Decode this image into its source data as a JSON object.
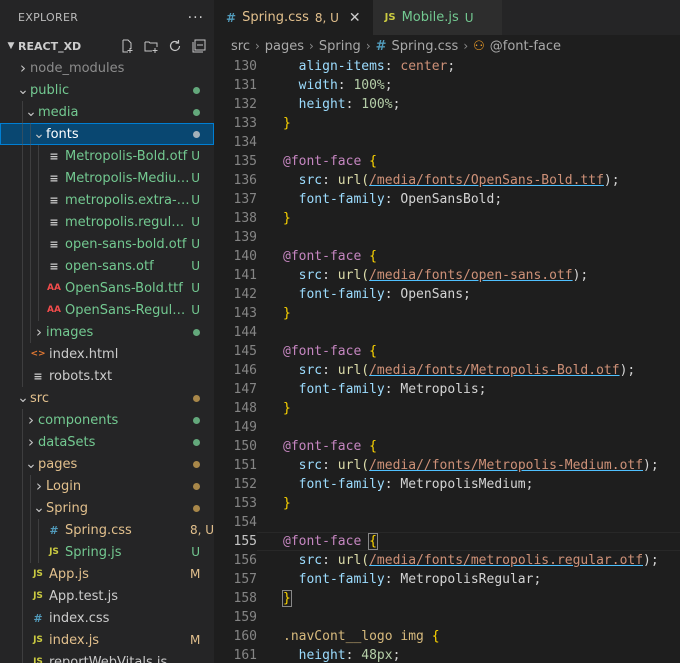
{
  "explorer": {
    "title": "EXPLORER",
    "more": "···"
  },
  "project": {
    "name": "REACT_XD"
  },
  "tree": [
    {
      "label": "node_modules",
      "depth": 1,
      "type": "folder",
      "open": false,
      "status": "",
      "dot": "",
      "labelColor": "#8c8c8c"
    },
    {
      "label": "public",
      "depth": 1,
      "type": "folder",
      "open": true,
      "status": "",
      "dot": "#73c991",
      "labelColor": "#73c991"
    },
    {
      "label": "media",
      "depth": 2,
      "type": "folder",
      "open": true,
      "status": "",
      "dot": "#73c991",
      "labelColor": "#73c991"
    },
    {
      "label": "fonts",
      "depth": 3,
      "type": "folder",
      "open": true,
      "status": "",
      "dot": "#73c991",
      "labelColor": "#ffffff",
      "selected": true
    },
    {
      "label": "Metropolis-Bold.otf",
      "depth": 4,
      "type": "font",
      "status": "U",
      "labelColor": "#73c991"
    },
    {
      "label": "Metropolis-Medium....",
      "depth": 4,
      "type": "font",
      "status": "U",
      "labelColor": "#73c991"
    },
    {
      "label": "metropolis.extra-bol...",
      "depth": 4,
      "type": "font",
      "status": "U",
      "labelColor": "#73c991"
    },
    {
      "label": "metropolis.regular.otf",
      "depth": 4,
      "type": "font",
      "status": "U",
      "labelColor": "#73c991"
    },
    {
      "label": "open-sans-bold.otf",
      "depth": 4,
      "type": "font",
      "status": "U",
      "labelColor": "#73c991"
    },
    {
      "label": "open-sans.otf",
      "depth": 4,
      "type": "font",
      "status": "U",
      "labelColor": "#73c991"
    },
    {
      "label": "OpenSans-Bold.ttf",
      "depth": 4,
      "type": "ttf",
      "status": "U",
      "labelColor": "#73c991"
    },
    {
      "label": "OpenSans-Regular.ttf",
      "depth": 4,
      "type": "ttf",
      "status": "U",
      "labelColor": "#73c991"
    },
    {
      "label": "images",
      "depth": 3,
      "type": "folder",
      "open": false,
      "status": "",
      "dot": "#73c991",
      "labelColor": "#73c991"
    },
    {
      "label": "index.html",
      "depth": 2,
      "type": "html",
      "status": "",
      "labelColor": "#cccccc"
    },
    {
      "label": "robots.txt",
      "depth": 2,
      "type": "txt",
      "status": "",
      "labelColor": "#cccccc"
    },
    {
      "label": "src",
      "depth": 1,
      "type": "folder",
      "open": true,
      "status": "",
      "dot": "#c9a053",
      "labelColor": "#e2c08d"
    },
    {
      "label": "components",
      "depth": 2,
      "type": "folder",
      "open": false,
      "status": "",
      "dot": "#73c991",
      "labelColor": "#73c991"
    },
    {
      "label": "dataSets",
      "depth": 2,
      "type": "folder",
      "open": false,
      "status": "",
      "dot": "#73c991",
      "labelColor": "#73c991"
    },
    {
      "label": "pages",
      "depth": 2,
      "type": "folder",
      "open": true,
      "status": "",
      "dot": "#c9a053",
      "labelColor": "#e2c08d"
    },
    {
      "label": "Login",
      "depth": 3,
      "type": "folder",
      "open": false,
      "status": "",
      "dot": "#c9a053",
      "labelColor": "#e2c08d"
    },
    {
      "label": "Spring",
      "depth": 3,
      "type": "folder",
      "open": true,
      "status": "",
      "dot": "#c9a053",
      "labelColor": "#e2c08d"
    },
    {
      "label": "Spring.css",
      "depth": 4,
      "type": "css",
      "status": "8, U",
      "labelColor": "#e2c08d"
    },
    {
      "label": "Spring.js",
      "depth": 4,
      "type": "js",
      "status": "U",
      "labelColor": "#73c991"
    },
    {
      "label": "App.js",
      "depth": 2,
      "type": "js",
      "status": "M",
      "labelColor": "#e2c08d"
    },
    {
      "label": "App.test.js",
      "depth": 2,
      "type": "js",
      "status": "",
      "labelColor": "#cccccc"
    },
    {
      "label": "index.css",
      "depth": 2,
      "type": "css",
      "status": "",
      "labelColor": "#cccccc"
    },
    {
      "label": "index.js",
      "depth": 2,
      "type": "js",
      "status": "M",
      "labelColor": "#e2c08d"
    },
    {
      "label": "reportWebVitals.js",
      "depth": 2,
      "type": "js",
      "status": "",
      "labelColor": "#cccccc"
    }
  ],
  "tabs": [
    {
      "icon": "#",
      "iconColor": "#519aba",
      "name": "Spring.css",
      "status": "8, U",
      "close": "✕",
      "active": true
    },
    {
      "icon": "JS",
      "iconColor": "#cbcb41",
      "name": "Mobile.js",
      "status": "U",
      "close": "",
      "active": false
    }
  ],
  "breadcrumb": {
    "parts": [
      "src",
      "pages",
      "Spring"
    ],
    "file_icon": "#",
    "file": "Spring.css",
    "symbol_icon": "⚇",
    "symbol": "@font-face"
  },
  "editor": {
    "current_line": 155,
    "lines": [
      {
        "n": "130",
        "tokens": [
          [
            "  ",
            "p"
          ],
          [
            "align-items",
            "prop"
          ],
          [
            ": ",
            "p"
          ],
          [
            "center",
            "val"
          ],
          [
            ";",
            "p"
          ]
        ]
      },
      {
        "n": "131",
        "tokens": [
          [
            "  ",
            "p"
          ],
          [
            "width",
            "prop"
          ],
          [
            ": ",
            "p"
          ],
          [
            "100%",
            "num"
          ],
          [
            ";",
            "p"
          ]
        ]
      },
      {
        "n": "132",
        "tokens": [
          [
            "  ",
            "p"
          ],
          [
            "height",
            "prop"
          ],
          [
            ": ",
            "p"
          ],
          [
            "100%",
            "num"
          ],
          [
            ";",
            "p"
          ]
        ]
      },
      {
        "n": "133",
        "tokens": [
          [
            "}",
            "brace"
          ]
        ]
      },
      {
        "n": "134",
        "tokens": []
      },
      {
        "n": "135",
        "tokens": [
          [
            "@font-face",
            "at"
          ],
          [
            " ",
            "p"
          ],
          [
            "{",
            "brace"
          ]
        ]
      },
      {
        "n": "136",
        "tokens": [
          [
            "  ",
            "p"
          ],
          [
            "src",
            "prop"
          ],
          [
            ": ",
            "p"
          ],
          [
            "url(",
            "fn"
          ],
          [
            "/media/fonts/OpenSans-Bold.ttf",
            "url"
          ],
          [
            ");",
            "p"
          ]
        ]
      },
      {
        "n": "137",
        "tokens": [
          [
            "  ",
            "p"
          ],
          [
            "font-family",
            "prop"
          ],
          [
            ": OpenSansBold;",
            "p"
          ]
        ]
      },
      {
        "n": "138",
        "tokens": [
          [
            "}",
            "brace"
          ]
        ]
      },
      {
        "n": "139",
        "tokens": []
      },
      {
        "n": "140",
        "tokens": [
          [
            "@font-face",
            "at"
          ],
          [
            " ",
            "p"
          ],
          [
            "{",
            "brace"
          ]
        ]
      },
      {
        "n": "141",
        "tokens": [
          [
            "  ",
            "p"
          ],
          [
            "src",
            "prop"
          ],
          [
            ": ",
            "p"
          ],
          [
            "url(",
            "fn"
          ],
          [
            "/media/fonts/open-sans.otf",
            "url"
          ],
          [
            ");",
            "p"
          ]
        ]
      },
      {
        "n": "142",
        "tokens": [
          [
            "  ",
            "p"
          ],
          [
            "font-family",
            "prop"
          ],
          [
            ": OpenSans;",
            "p"
          ]
        ]
      },
      {
        "n": "143",
        "tokens": [
          [
            "}",
            "brace"
          ]
        ]
      },
      {
        "n": "144",
        "tokens": []
      },
      {
        "n": "145",
        "tokens": [
          [
            "@font-face",
            "at"
          ],
          [
            " ",
            "p"
          ],
          [
            "{",
            "brace"
          ]
        ]
      },
      {
        "n": "146",
        "tokens": [
          [
            "  ",
            "p"
          ],
          [
            "src",
            "prop"
          ],
          [
            ": ",
            "p"
          ],
          [
            "url(",
            "fn"
          ],
          [
            "/media/fonts/Metropolis-Bold.otf",
            "url"
          ],
          [
            ");",
            "p"
          ]
        ]
      },
      {
        "n": "147",
        "tokens": [
          [
            "  ",
            "p"
          ],
          [
            "font-family",
            "prop"
          ],
          [
            ": Metropolis;",
            "p"
          ]
        ]
      },
      {
        "n": "148",
        "tokens": [
          [
            "}",
            "brace"
          ]
        ]
      },
      {
        "n": "149",
        "tokens": []
      },
      {
        "n": "150",
        "tokens": [
          [
            "@font-face",
            "at"
          ],
          [
            " ",
            "p"
          ],
          [
            "{",
            "brace"
          ]
        ]
      },
      {
        "n": "151",
        "tokens": [
          [
            "  ",
            "p"
          ],
          [
            "src",
            "prop"
          ],
          [
            ": ",
            "p"
          ],
          [
            "url(",
            "fn"
          ],
          [
            "/media//fonts/Metropolis-Medium.otf",
            "url"
          ],
          [
            ");",
            "p"
          ]
        ]
      },
      {
        "n": "152",
        "tokens": [
          [
            "  ",
            "p"
          ],
          [
            "font-family",
            "prop"
          ],
          [
            ": MetropolisMedium;",
            "p"
          ]
        ]
      },
      {
        "n": "153",
        "tokens": [
          [
            "}",
            "brace"
          ]
        ]
      },
      {
        "n": "154",
        "tokens": []
      },
      {
        "n": "155",
        "tokens": [
          [
            "@font-face",
            "at"
          ],
          [
            " ",
            "p"
          ],
          [
            "{",
            "bracehl"
          ]
        ]
      },
      {
        "n": "156",
        "tokens": [
          [
            "  ",
            "p"
          ],
          [
            "src",
            "prop"
          ],
          [
            ": ",
            "p"
          ],
          [
            "url(",
            "fn"
          ],
          [
            "/media/fonts/metropolis.regular.otf",
            "url"
          ],
          [
            ");",
            "p"
          ]
        ]
      },
      {
        "n": "157",
        "tokens": [
          [
            "  ",
            "p"
          ],
          [
            "font-family",
            "prop"
          ],
          [
            ": MetropolisRegular;",
            "p"
          ]
        ]
      },
      {
        "n": "158",
        "tokens": [
          [
            "}",
            "bracehl"
          ]
        ]
      },
      {
        "n": "159",
        "tokens": []
      },
      {
        "n": "160",
        "tokens": [
          [
            ".navCont__logo",
            "sel"
          ],
          [
            " ",
            "p"
          ],
          [
            "img",
            "tag"
          ],
          [
            " ",
            "p"
          ],
          [
            "{",
            "brace"
          ]
        ]
      },
      {
        "n": "161",
        "tokens": [
          [
            "  ",
            "p"
          ],
          [
            "height",
            "prop"
          ],
          [
            ": ",
            "p"
          ],
          [
            "48px",
            "num"
          ],
          [
            ";",
            "p"
          ]
        ]
      }
    ]
  }
}
